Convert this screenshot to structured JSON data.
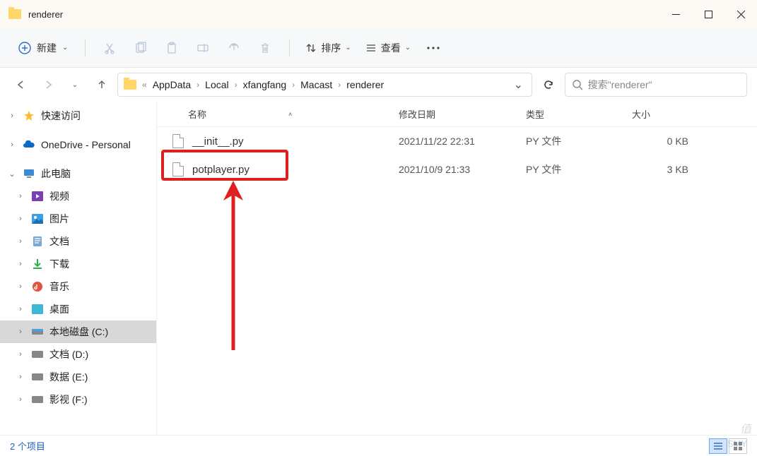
{
  "window": {
    "title": "renderer"
  },
  "toolbar": {
    "new_label": "新建",
    "sort_label": "排序",
    "view_label": "查看"
  },
  "breadcrumb": {
    "items": [
      "AppData",
      "Local",
      "xfangfang",
      "Macast",
      "renderer"
    ]
  },
  "search": {
    "placeholder": "搜索\"renderer\""
  },
  "sidebar": {
    "quick_access": "快速访问",
    "onedrive": "OneDrive - Personal",
    "this_pc": "此电脑",
    "videos": "视频",
    "pictures": "图片",
    "documents": "文档",
    "downloads": "下载",
    "music": "音乐",
    "desktop": "桌面",
    "drive_c": "本地磁盘 (C:)",
    "drive_d": "文档 (D:)",
    "drive_e": "数据 (E:)",
    "drive_f": "影视 (F:)"
  },
  "columns": {
    "name": "名称",
    "date": "修改日期",
    "type": "类型",
    "size": "大小"
  },
  "files": [
    {
      "name": "__init__.py",
      "date": "2021/11/22 22:31",
      "type": "PY 文件",
      "size": "0 KB"
    },
    {
      "name": "potplayer.py",
      "date": "2021/10/9 21:33",
      "type": "PY 文件",
      "size": "3 KB"
    }
  ],
  "status": {
    "count": "2 个项目"
  },
  "watermark": {
    "text1": "值",
    "text2": "SMY"
  }
}
